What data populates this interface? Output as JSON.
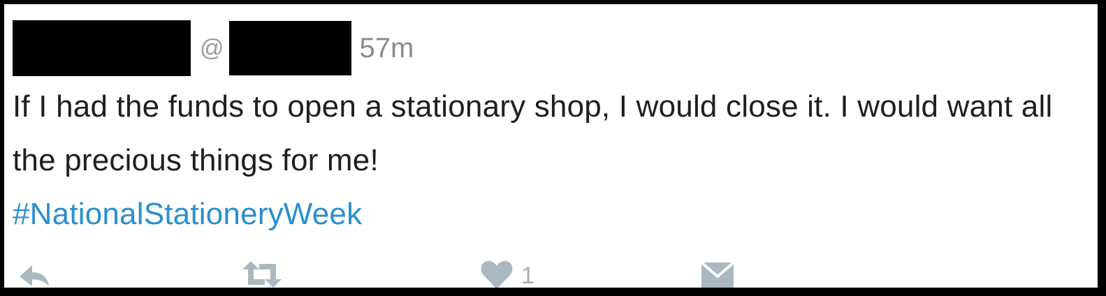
{
  "tweet": {
    "at_symbol": "@",
    "timestamp": "57m",
    "text": "If I had the funds to open a stationary shop, I would close it. I would want all the precious things for me!",
    "hashtag": "#NationalStationeryWeek",
    "likes": "1"
  },
  "colors": {
    "hashtag": "#2b8fce",
    "icon": "#aab8c2",
    "redaction": "#000000"
  },
  "icons": [
    "reply-icon",
    "retweet-icon",
    "heart-icon",
    "message-icon"
  ]
}
